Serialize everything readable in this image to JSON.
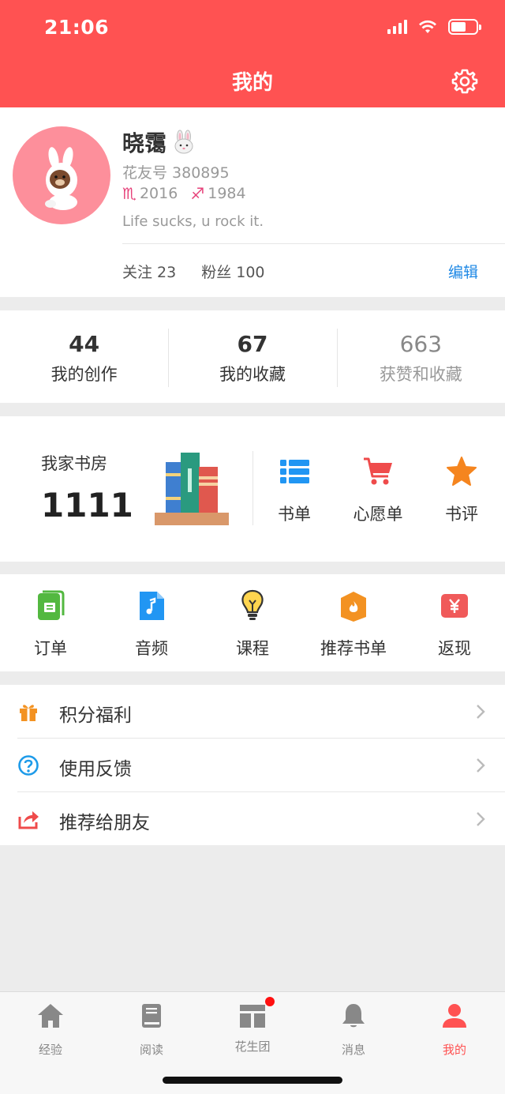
{
  "status_bar": {
    "time": "21:06"
  },
  "header": {
    "title": "我的"
  },
  "profile": {
    "nickname": "晓霭",
    "uid": "花友号 380895",
    "zodiac1": "2016",
    "zodiac2": "1984",
    "motto": "Life sucks, u rock it.",
    "following": "关注 23",
    "followers": "粉丝 100",
    "edit_label": "编辑"
  },
  "stats": [
    {
      "value": "44",
      "label": "我的创作"
    },
    {
      "value": "67",
      "label": "我的收藏"
    },
    {
      "value": "663",
      "label": "获赞和收藏"
    }
  ],
  "study": {
    "label": "我家书房",
    "count": "1111",
    "actions": [
      {
        "label": "书单",
        "icon": "list-icon"
      },
      {
        "label": "心愿单",
        "icon": "cart-icon"
      },
      {
        "label": "书评",
        "icon": "star-icon"
      }
    ]
  },
  "services": [
    {
      "label": "订单",
      "icon": "order-icon"
    },
    {
      "label": "音频",
      "icon": "audio-file-icon"
    },
    {
      "label": "课程",
      "icon": "lightbulb-icon"
    },
    {
      "label": "推荐书单",
      "icon": "hot-icon"
    },
    {
      "label": "返现",
      "icon": "yen-icon"
    }
  ],
  "menu": [
    {
      "label": "积分福利",
      "icon": "gift-icon"
    },
    {
      "label": "使用反馈",
      "icon": "question-icon"
    },
    {
      "label": "推荐给朋友",
      "icon": "share-icon"
    }
  ],
  "tabs": [
    {
      "label": "经验",
      "icon": "home-icon"
    },
    {
      "label": "阅读",
      "icon": "book-icon"
    },
    {
      "label": "花生团",
      "icon": "group-icon"
    },
    {
      "label": "消息",
      "icon": "bell-icon"
    },
    {
      "label": "我的",
      "icon": "user-icon"
    }
  ],
  "colors": {
    "brand": "#ff5252",
    "link": "#1e88e5",
    "star": "#f5851f",
    "cart": "#ef4b4b",
    "list": "#2196f3"
  }
}
